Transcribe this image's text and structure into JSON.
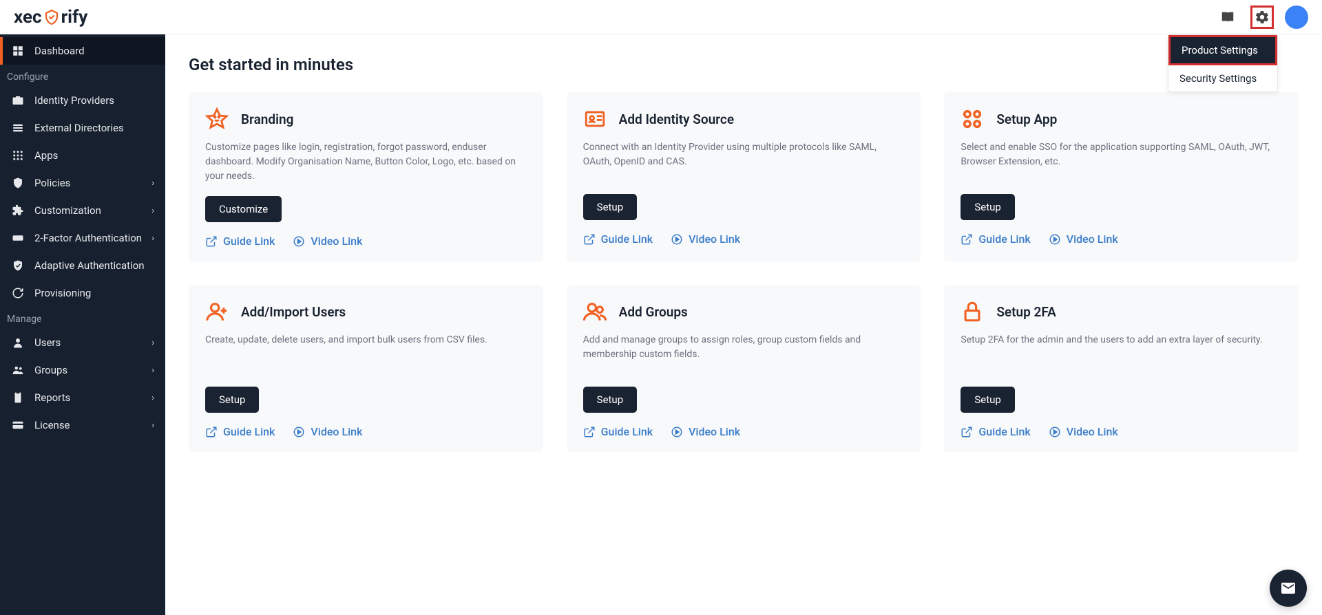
{
  "brand": {
    "pre": "xec",
    "post": "rify"
  },
  "settings_menu": {
    "product": "Product Settings",
    "security": "Security Settings"
  },
  "sidebar": {
    "dashboard": "Dashboard",
    "section_configure": "Configure",
    "identity_providers": "Identity Providers",
    "external_directories": "External Directories",
    "apps": "Apps",
    "policies": "Policies",
    "customization": "Customization",
    "two_factor": "2-Factor Authentication",
    "adaptive": "Adaptive Authentication",
    "provisioning": "Provisioning",
    "section_manage": "Manage",
    "users": "Users",
    "groups": "Groups",
    "reports": "Reports",
    "license": "License"
  },
  "page": {
    "title": "Get started in minutes"
  },
  "links": {
    "guide": "Guide Link",
    "video": "Video Link"
  },
  "cards": {
    "branding": {
      "title": "Branding",
      "desc": "Customize pages like login, registration, forgot password, enduser dashboard. Modify Organisation Name, Button Color, Logo, etc. based on your needs.",
      "btn": "Customize"
    },
    "identity": {
      "title": "Add Identity Source",
      "desc": "Connect with an Identity Provider using multiple protocols like SAML, OAuth, OpenID and CAS.",
      "btn": "Setup"
    },
    "app": {
      "title": "Setup App",
      "desc": "Select and enable SSO for the application supporting SAML, OAuth, JWT, Browser Extension, etc.",
      "btn": "Setup"
    },
    "users": {
      "title": "Add/Import Users",
      "desc": "Create, update, delete users, and import bulk users from CSV files.",
      "btn": "Setup"
    },
    "groups2": {
      "title": "Add Groups",
      "desc": "Add and manage groups to assign roles, group custom fields and membership custom fields.",
      "btn": "Setup"
    },
    "twofa": {
      "title": "Setup 2FA",
      "desc": "Setup 2FA for the admin and the users to add an extra layer of security.",
      "btn": "Setup"
    }
  }
}
